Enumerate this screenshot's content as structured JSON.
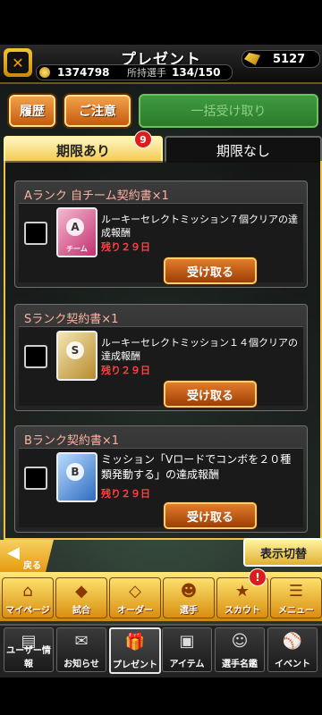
{
  "header": {
    "title": "プレゼント",
    "logo_glyph": "✕",
    "coins": "1374798",
    "roster_label": "所持選手",
    "roster_count": "134/150",
    "gems": "5127"
  },
  "toolbar": {
    "history_label": "履歴",
    "notice_label": "ご注意",
    "receive_all_label": "一括受け取り"
  },
  "tabs": {
    "limited_label": "期限あり",
    "limited_badge": "9",
    "unlimited_label": "期限なし"
  },
  "items": [
    {
      "title": "Aランク 自チーム契約書×1",
      "icon": "contract-a-icon",
      "icon_letter": "A",
      "icon_tag": "チーム",
      "description": "ルーキーセレクトミッション７個クリアの達成報酬",
      "remaining": "残り２９日",
      "button_label": "受け取る"
    },
    {
      "title": "Sランク契約書×1",
      "icon": "contract-s-icon",
      "icon_letter": "S",
      "icon_tag": "",
      "description": "ルーキーセレクトミッション１４個クリアの達成報酬",
      "remaining": "残り２９日",
      "button_label": "受け取る"
    },
    {
      "title": "Bランク契約書×1",
      "icon": "contract-b-icon",
      "icon_letter": "B",
      "icon_tag": "",
      "description": "ミッション「Vロードでコンボを２０種類発動する」の達成報酬",
      "remaining": "残り２９日",
      "button_label": "受け取る"
    }
  ],
  "bottom": {
    "back_label": "戻る",
    "toggle_label": "表示切替",
    "alert": "!"
  },
  "nav_primary": [
    {
      "label": "マイページ",
      "icon": "mypage-icon",
      "glyph": "⌂"
    },
    {
      "label": "試合",
      "icon": "match-icon",
      "glyph": "◆"
    },
    {
      "label": "オーダー",
      "icon": "order-icon",
      "glyph": "◇"
    },
    {
      "label": "選手",
      "icon": "player-icon",
      "glyph": "☻"
    },
    {
      "label": "スカウト",
      "icon": "scout-icon",
      "glyph": "★"
    },
    {
      "label": "メニュー",
      "icon": "menu-icon",
      "glyph": "☰"
    }
  ],
  "nav_secondary": [
    {
      "label": "ユーザー情報",
      "icon": "user-info-icon",
      "glyph": "▤"
    },
    {
      "label": "お知らせ",
      "icon": "notice-icon",
      "glyph": "✉"
    },
    {
      "label": "プレゼント",
      "icon": "present-icon",
      "glyph": "🎁"
    },
    {
      "label": "アイテム",
      "icon": "item-icon",
      "glyph": "▣"
    },
    {
      "label": "選手名鑑",
      "icon": "player-book-icon",
      "glyph": "☺"
    },
    {
      "label": "イベント",
      "icon": "event-icon",
      "glyph": "⚾"
    }
  ],
  "colors": {
    "accent_gold": "#f0c04a",
    "alert_red": "#e01b1b",
    "remaining_red": "#ff4040"
  }
}
